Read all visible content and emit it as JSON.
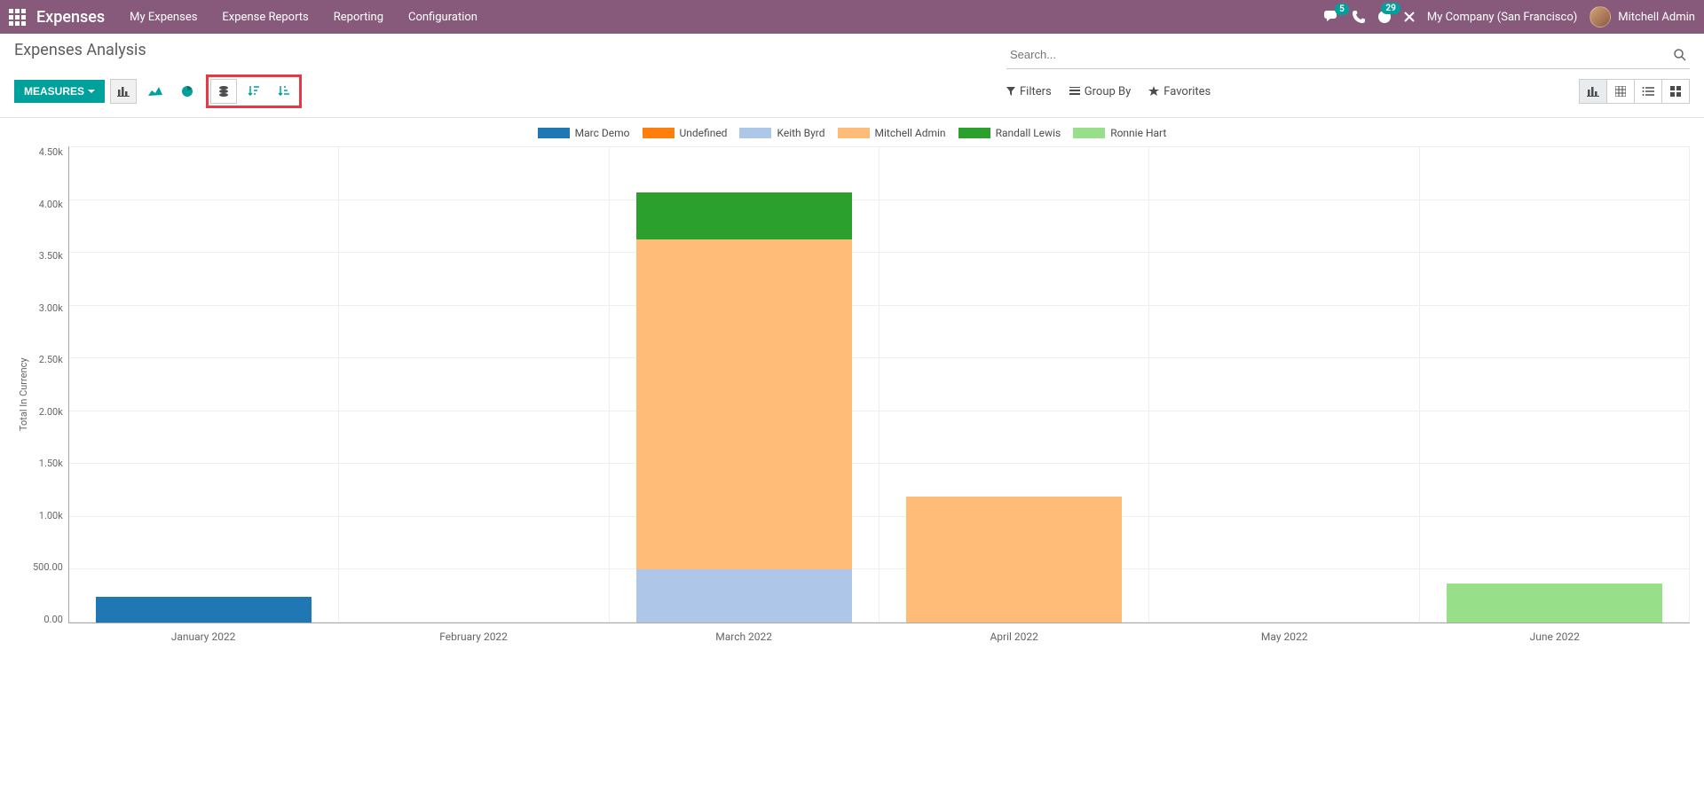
{
  "topbar": {
    "app_title": "Expenses",
    "nav": [
      "My Expenses",
      "Expense Reports",
      "Reporting",
      "Configuration"
    ],
    "conversations_badge": "5",
    "activities_badge": "29",
    "company": "My Company (San Francisco)",
    "user": "Mitchell Admin"
  },
  "page": {
    "title": "Expenses Analysis",
    "measures_label": "MEASURES",
    "search_placeholder": "Search...",
    "filters_label": "Filters",
    "groupby_label": "Group By",
    "favorites_label": "Favorites"
  },
  "chart_data": {
    "type": "bar",
    "stacked": true,
    "ylabel": "Total In Currency",
    "xlabel": "",
    "ylim": [
      0,
      4500
    ],
    "yticks": [
      "0.00",
      "500.00",
      "1.00k",
      "1.50k",
      "2.00k",
      "2.50k",
      "3.00k",
      "3.50k",
      "4.00k",
      "4.50k"
    ],
    "categories": [
      "January 2022",
      "February 2022",
      "March 2022",
      "April 2022",
      "May 2022",
      "June 2022"
    ],
    "series": [
      {
        "name": "Marc Demo",
        "color": "#1f77b4",
        "values": [
          245,
          0,
          0,
          0,
          0,
          0
        ]
      },
      {
        "name": "Undefined",
        "color": "#ff7f0e",
        "values": [
          0,
          0,
          0,
          0,
          0,
          0
        ]
      },
      {
        "name": "Keith Byrd",
        "color": "#aec7e8",
        "values": [
          0,
          0,
          500,
          0,
          0,
          0
        ]
      },
      {
        "name": "Mitchell Admin",
        "color": "#ffbb78",
        "values": [
          0,
          0,
          3100,
          1180,
          0,
          0
        ]
      },
      {
        "name": "Randall Lewis",
        "color": "#2ca02c",
        "values": [
          0,
          0,
          440,
          0,
          0,
          0
        ]
      },
      {
        "name": "Ronnie Hart",
        "color": "#98df8a",
        "values": [
          0,
          0,
          0,
          0,
          0,
          370
        ]
      }
    ]
  }
}
